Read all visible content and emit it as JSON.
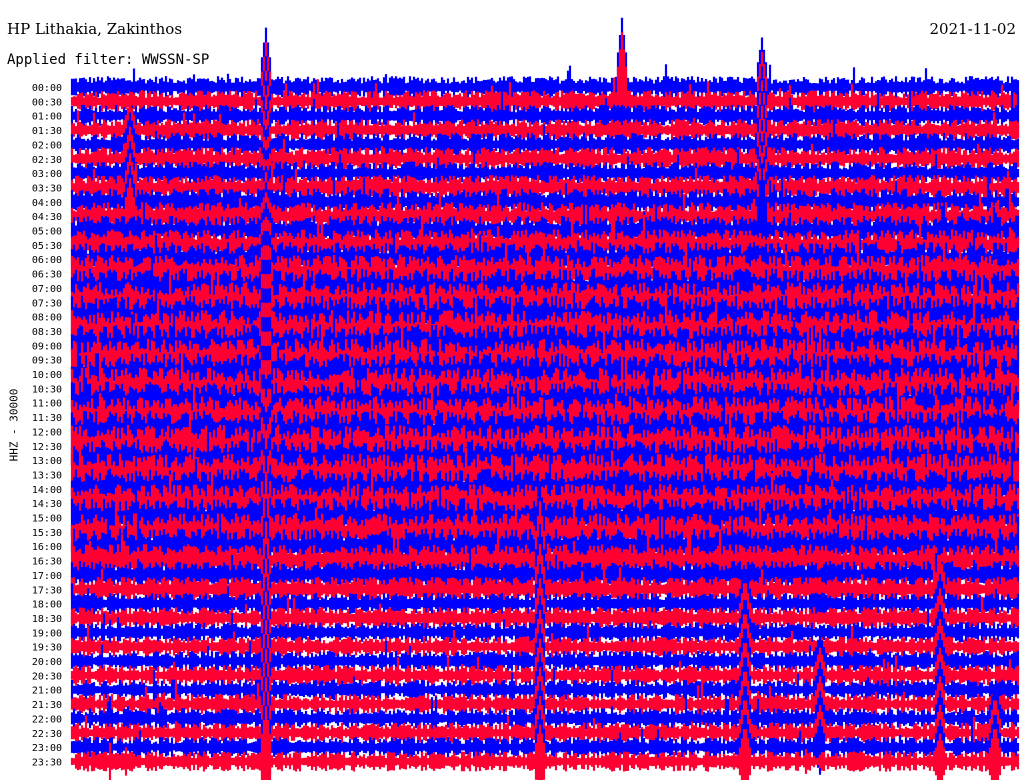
{
  "header": {
    "station": "HP Lithakia, Zakinthos",
    "filter": "Applied filter: WWSSN-SP",
    "date": "2021-11-02"
  },
  "side_label": "HHZ - 30000",
  "chart_data": {
    "type": "line",
    "title": "HP Lithakia, Zakinthos",
    "subtitle": "Applied filter: WWSSN-SP",
    "date": "2021-11-02",
    "ylabel": "HHZ - 30000",
    "row_labels": [
      "00:00",
      "00:30",
      "01:00",
      "01:30",
      "02:00",
      "02:30",
      "03:00",
      "03:30",
      "04:00",
      "04:30",
      "05:00",
      "05:30",
      "06:00",
      "06:30",
      "07:00",
      "07:30",
      "08:00",
      "08:30",
      "09:00",
      "09:30",
      "10:00",
      "10:30",
      "11:00",
      "11:30",
      "12:00",
      "12:30",
      "13:00",
      "13:30",
      "14:00",
      "14:30",
      "15:00",
      "15:30",
      "16:00",
      "16:30",
      "17:00",
      "17:30",
      "18:00",
      "18:30",
      "19:00",
      "19:30",
      "20:00",
      "20:30",
      "21:00",
      "21:30",
      "22:00",
      "22:30",
      "23:00",
      "23:30"
    ],
    "row_colors": [
      "#0000ff",
      "#ff0033"
    ],
    "noise_profile": [
      0.35,
      0.35,
      0.35,
      0.35,
      0.4,
      0.4,
      0.4,
      0.45,
      0.5,
      0.55,
      0.6,
      0.65,
      0.75,
      0.85,
      0.9,
      0.95,
      1.0,
      1.0,
      1.0,
      1.0,
      1.0,
      1.0,
      1.0,
      1.0,
      1.0,
      1.0,
      1.0,
      1.0,
      0.95,
      0.9,
      0.9,
      0.85,
      0.8,
      0.7,
      0.55,
      0.45,
      0.35,
      0.35,
      0.3,
      0.3,
      0.3,
      0.3,
      0.3,
      0.3,
      0.3,
      0.3,
      0.3,
      0.3
    ],
    "grid": false
  }
}
